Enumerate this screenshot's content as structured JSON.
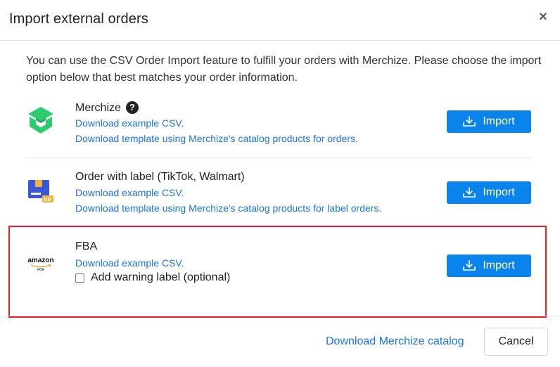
{
  "modal": {
    "title": "Import external orders",
    "close_label": "×"
  },
  "intro": "You can use the CSV Order Import feature to fulfill your orders with Merchize. Please choose the import option below that best matches your order information.",
  "options": [
    {
      "title": "Merchize",
      "icon": "merchize-logo-icon",
      "help_icon": "?",
      "links": [
        "Download example CSV.",
        "Download template using Merchize's catalog products for orders."
      ],
      "import_label": "Import"
    },
    {
      "title": "Order with label (TikTok, Walmart)",
      "icon": "label-box-icon",
      "links": [
        "Download example CSV.",
        "Download template using Merchize's catalog products for label orders."
      ],
      "import_label": "Import"
    },
    {
      "title": "FBA",
      "icon": "amazon-fba-logo",
      "logo_text": "amazon",
      "logo_subtext": "FBA",
      "links": [
        "Download example CSV."
      ],
      "checkbox_label": "Add warning label (optional)",
      "checkbox_checked": false,
      "import_label": "Import"
    }
  ],
  "footer": {
    "catalog_link": "Download Merchize catalog",
    "cancel_label": "Cancel"
  },
  "colors": {
    "primary": "#0a84ec",
    "link": "#1a73e8",
    "merchize_green": "#2ecc71",
    "highlight": "#ee1c25"
  }
}
